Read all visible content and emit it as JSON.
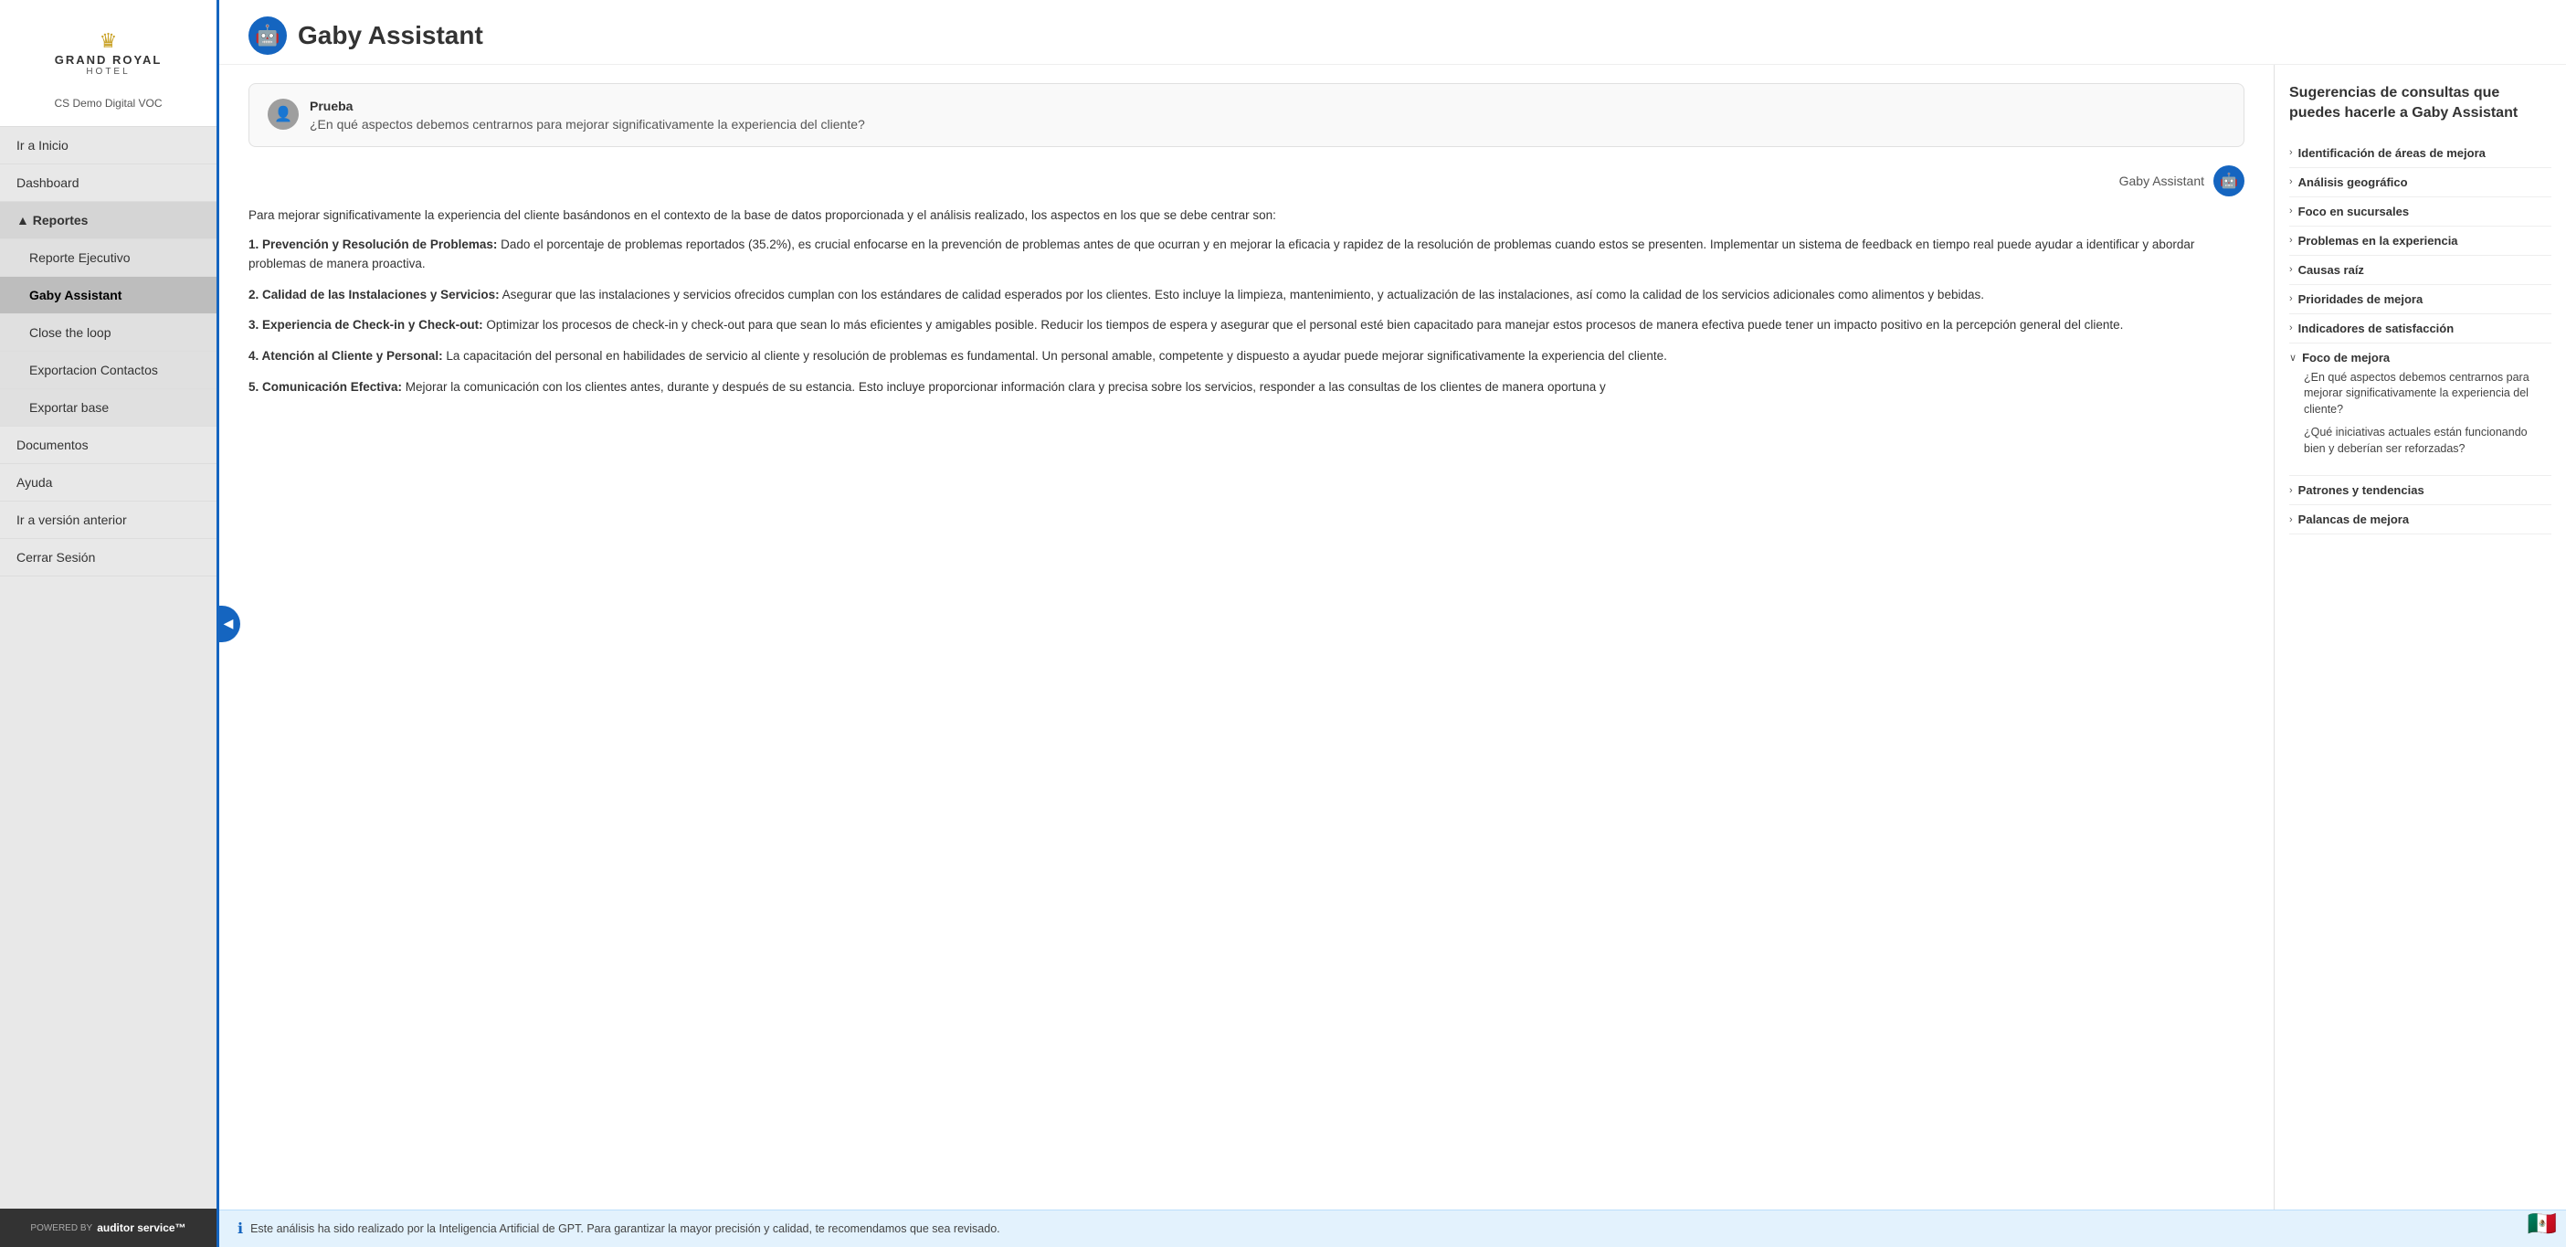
{
  "sidebar": {
    "logo": {
      "crown": "♛",
      "line1": "GRAND ROYAL",
      "line2": "HOTEL"
    },
    "subtitle": "CS Demo Digital VOC",
    "nav_items": [
      {
        "id": "ir-inicio",
        "label": "Ir a Inicio",
        "type": "top",
        "active": false
      },
      {
        "id": "dashboard",
        "label": "Dashboard",
        "type": "top",
        "active": false
      },
      {
        "id": "reportes",
        "label": "▲ Reportes",
        "type": "section",
        "active": false
      },
      {
        "id": "reporte-ejecutivo",
        "label": "Reporte Ejecutivo",
        "type": "sub",
        "active": false
      },
      {
        "id": "gaby-assistant",
        "label": "Gaby Assistant",
        "type": "sub",
        "active": true
      },
      {
        "id": "close-loop",
        "label": "Close the loop",
        "type": "sub",
        "active": false
      },
      {
        "id": "exportacion-contactos",
        "label": "Exportacion Contactos",
        "type": "sub",
        "active": false
      },
      {
        "id": "exportar-base",
        "label": "Exportar base",
        "type": "sub",
        "active": false
      },
      {
        "id": "documentos",
        "label": "Documentos",
        "type": "top",
        "active": false
      },
      {
        "id": "ayuda",
        "label": "Ayuda",
        "type": "top",
        "active": false
      },
      {
        "id": "version-anterior",
        "label": "Ir a versión anterior",
        "type": "top",
        "active": false
      },
      {
        "id": "cerrar-sesion",
        "label": "Cerrar Sesión",
        "type": "top",
        "active": false
      }
    ],
    "footer": {
      "powered_by": "POWERED BY",
      "brand": "auditor service™"
    }
  },
  "page": {
    "title": "Gaby Assistant",
    "robot_icon": "🤖"
  },
  "user_message": {
    "user_name": "Prueba",
    "text": "¿En qué aspectos debemos centrarnos para mejorar significativamente la experiencia del cliente?"
  },
  "assistant": {
    "name": "Gaby Assistant",
    "intro": "Para mejorar significativamente la experiencia del cliente basándonos en el contexto de la base de datos proporcionada y el análisis realizado, los aspectos en los que se debe centrar son:",
    "items": [
      {
        "num": "1.",
        "title": "Prevención y Resolución de Problemas:",
        "text": "Dado el porcentaje de problemas reportados (35.2%), es crucial enfocarse en la prevención de problemas antes de que ocurran y en mejorar la eficacia y rapidez de la resolución de problemas cuando estos se presenten. Implementar un sistema de feedback en tiempo real puede ayudar a identificar y abordar problemas de manera proactiva."
      },
      {
        "num": "2.",
        "title": "Calidad de las Instalaciones y Servicios:",
        "text": "Asegurar que las instalaciones y servicios ofrecidos cumplan con los estándares de calidad esperados por los clientes. Esto incluye la limpieza, mantenimiento, y actualización de las instalaciones, así como la calidad de los servicios adicionales como alimentos y bebidas."
      },
      {
        "num": "3.",
        "title": "Experiencia de Check-in y Check-out:",
        "text": "Optimizar los procesos de check-in y check-out para que sean lo más eficientes y amigables posible. Reducir los tiempos de espera y asegurar que el personal esté bien capacitado para manejar estos procesos de manera efectiva puede tener un impacto positivo en la percepción general del cliente."
      },
      {
        "num": "4.",
        "title": "Atención al Cliente y Personal:",
        "text": "La capacitación del personal en habilidades de servicio al cliente y resolución de problemas es fundamental. Un personal amable, competente y dispuesto a ayudar puede mejorar significativamente la experiencia del cliente."
      },
      {
        "num": "5.",
        "title": "Comunicación Efectiva:",
        "text": "Mejorar la comunicación con los clientes antes, durante y después de su estancia. Esto incluye proporcionar información clara y precisa sobre los servicios, responder a las consultas de los clientes de manera oportuna y"
      }
    ]
  },
  "bottom_notice": {
    "text": "Este análisis ha sido realizado por la Inteligencia Artificial de GPT. Para garantizar la mayor precisión y calidad, te recomendamos que sea revisado."
  },
  "right_panel": {
    "title": "Sugerencias de consultas que puedes hacerle a Gaby Assistant",
    "suggestions": [
      {
        "id": "areas-mejora",
        "label": "Identificación de áreas de mejora",
        "expanded": false,
        "sub_items": []
      },
      {
        "id": "analisis-geografico",
        "label": "Análisis geográfico",
        "expanded": false,
        "sub_items": []
      },
      {
        "id": "foco-sucursales",
        "label": "Foco en sucursales",
        "expanded": false,
        "sub_items": []
      },
      {
        "id": "problemas-experiencia",
        "label": "Problemas en la experiencia",
        "expanded": false,
        "sub_items": []
      },
      {
        "id": "causas-raiz",
        "label": "Causas raíz",
        "expanded": false,
        "sub_items": []
      },
      {
        "id": "prioridades-mejora",
        "label": "Prioridades de mejora",
        "expanded": false,
        "sub_items": []
      },
      {
        "id": "indicadores-satisfaccion",
        "label": "Indicadores de satisfacción",
        "expanded": false,
        "sub_items": []
      },
      {
        "id": "foco-mejora",
        "label": "Foco de mejora",
        "expanded": true,
        "sub_items": [
          "¿En qué aspectos debemos centrarnos para mejorar significativamente la experiencia del cliente?",
          "¿Qué iniciativas actuales están funcionando bien y deberían ser reforzadas?"
        ]
      },
      {
        "id": "patrones-tendencias",
        "label": "Patrones y tendencias",
        "expanded": false,
        "sub_items": []
      },
      {
        "id": "palancas-mejora",
        "label": "Palancas de mejora",
        "expanded": false,
        "sub_items": []
      }
    ]
  },
  "collapse_btn": "◀",
  "flag": "🇲🇽"
}
